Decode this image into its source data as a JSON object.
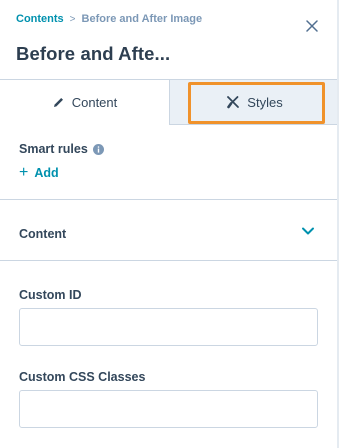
{
  "header": {
    "breadcrumb": {
      "link": "Contents",
      "separator": ">",
      "current": "Before and After Image"
    },
    "title": "Before and Afte..."
  },
  "tabs": [
    {
      "label": "Content",
      "icon": "pencil-icon",
      "active": true
    },
    {
      "label": "Styles",
      "icon": "styles-icon",
      "active": false
    }
  ],
  "smart_rules": {
    "label": "Smart rules",
    "add_label": "Add"
  },
  "content_section": {
    "title": "Content"
  },
  "fields": {
    "custom_id": {
      "label": "Custom ID",
      "value": "",
      "placeholder": ""
    },
    "custom_css": {
      "label": "Custom CSS Classes",
      "value": "",
      "placeholder": ""
    }
  },
  "colors": {
    "accent": "#0091ae",
    "highlight": "#f0922b",
    "text": "#33475b",
    "border": "#cbd6e2",
    "inactive_tab_bg": "#eaf0f6"
  }
}
